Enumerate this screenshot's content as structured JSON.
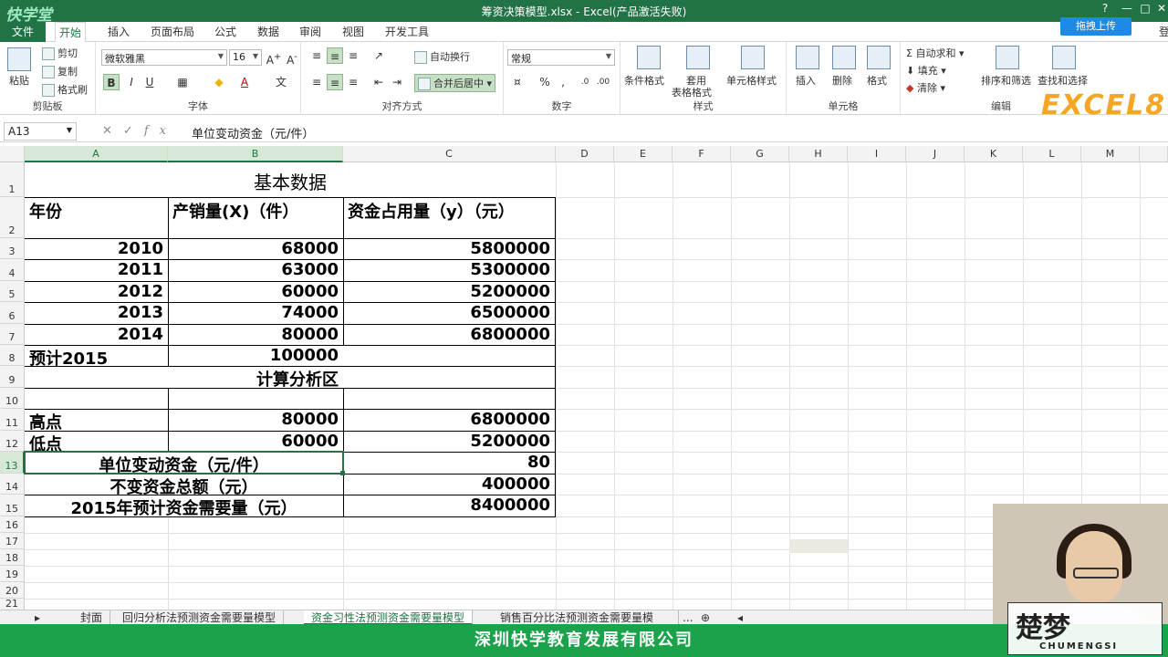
{
  "window": {
    "logo": "快学堂",
    "title": "筹资决策模型.xlsx -  Excel(产品激活失败)",
    "controls": [
      "?",
      "—",
      "□",
      "✕"
    ]
  },
  "ribbon_tabs": [
    "文件",
    "开始",
    "插入",
    "页面布局",
    "公式",
    "数据",
    "审阅",
    "视图",
    "开发工具"
  ],
  "upload_button": "拖拽上传",
  "account_initial": "登",
  "ribbon": {
    "clipboard": {
      "paste": "粘贴",
      "cut": "剪切",
      "copy": "复制",
      "format_painter": "格式刷",
      "label": "剪贴板"
    },
    "font": {
      "font_name": "微软雅黑",
      "font_size": "16",
      "bold": "B",
      "italic": "I",
      "underline": "U",
      "label": "字体"
    },
    "alignment": {
      "wrap": "自动换行",
      "merge": "合并后居中",
      "label": "对齐方式"
    },
    "number": {
      "format": "常规",
      "percent": "%",
      "comma": ",",
      "label": "数字"
    },
    "styles": {
      "conditional": "条件格式",
      "table_line1": "套用",
      "table_line2": "表格格式",
      "cell_styles": "单元格样式",
      "label": "样式"
    },
    "cells": {
      "insert": "插入",
      "delete": "删除",
      "format": "格式",
      "label": "单元格"
    },
    "editing": {
      "autosum": "自动求和",
      "fill": "填充",
      "clear": "清除",
      "sort": "排序和筛选",
      "find": "查找和选择",
      "label": "编辑"
    },
    "brand": "EXCEL8"
  },
  "formula_bar": {
    "name_box": "A13",
    "fx": "fx",
    "content": "单位变动资金（元/件）"
  },
  "columns": [
    "A",
    "B",
    "C",
    "D",
    "E",
    "F",
    "G",
    "H",
    "I",
    "J",
    "K",
    "L",
    "M"
  ],
  "rows": [
    "1",
    "2",
    "3",
    "4",
    "5",
    "6",
    "7",
    "8",
    "9",
    "10",
    "11",
    "12",
    "13",
    "14",
    "15",
    "16",
    "17",
    "18",
    "19",
    "20",
    "21"
  ],
  "sheet": {
    "title": "基本数据",
    "headers": [
      "年份",
      "产销量(X)（件）",
      "资金占用量（y）（元）"
    ],
    "data": [
      [
        "2010",
        "68000",
        "5800000"
      ],
      [
        "2011",
        "63000",
        "5300000"
      ],
      [
        "2012",
        "60000",
        "5200000"
      ],
      [
        "2013",
        "74000",
        "6500000"
      ],
      [
        "2014",
        "80000",
        "6800000"
      ]
    ],
    "forecast": [
      "预计2015",
      "100000"
    ],
    "analysis_title": "计算分析区",
    "high": [
      "高点",
      "80000",
      "6800000"
    ],
    "low": [
      "低点",
      "60000",
      "5200000"
    ],
    "unit_var": [
      "单位变动资金（元/件）",
      "80"
    ],
    "fixed": [
      "不变资金总额（元）",
      "400000"
    ],
    "need": [
      "2015年预计资金需要量（元）",
      "8400000"
    ]
  },
  "sheet_tabs": [
    "封面",
    "回归分析法预测资金需要量模型",
    "资金习性法预测资金需要量模型",
    "销售百分比法预测资金需要量模"
  ],
  "sheet_tabs_more": "...",
  "banner": "深圳快学教育发展有限公司",
  "watermark": {
    "big": "楚梦",
    "small": "CHUMENGSI"
  }
}
